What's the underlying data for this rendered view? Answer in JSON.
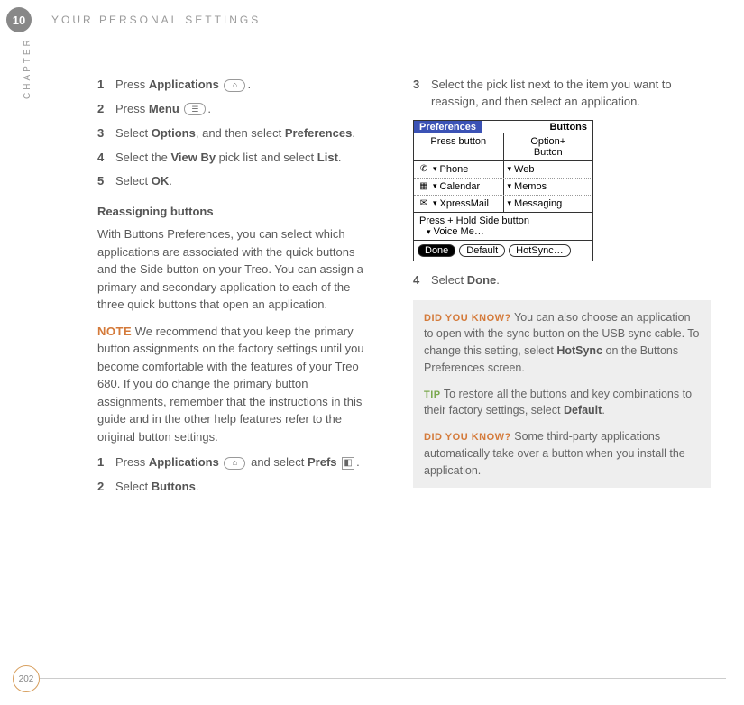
{
  "chapter_number": "10",
  "chapter_label": "CHAPTER",
  "section_title": "YOUR PERSONAL SETTINGS",
  "page_number": "202",
  "left": {
    "steps1": [
      {
        "num": "1",
        "pre": "Press ",
        "bold": "Applications",
        "post": " ",
        "icon": "applications-icon",
        "glyph": "⌂",
        "tail": "."
      },
      {
        "num": "2",
        "pre": "Press ",
        "bold": "Menu",
        "post": " ",
        "icon": "menu-icon",
        "glyph": "☰",
        "tail": "."
      },
      {
        "num": "3",
        "pre": "Select ",
        "bold": "Options",
        "post": ", and then select ",
        "bold2": "Preferences",
        "tail": "."
      },
      {
        "num": "4",
        "pre": "Select the ",
        "bold": "View By",
        "post": " pick list and select ",
        "bold2": "List",
        "tail": "."
      },
      {
        "num": "5",
        "pre": "Select ",
        "bold": "OK",
        "post": "",
        "tail": "."
      }
    ],
    "subhead": "Reassigning buttons",
    "para1": "With Buttons Preferences, you can select which applications are associated with the quick buttons and the Side button on your Treo. You can assign a primary and secondary application to each of the three quick buttons that open an application.",
    "note_label": "NOTE",
    "note_text": "We recommend that you keep the primary button assignments on the factory settings until you become comfortable with the features of your Treo 680. If you do change the primary button assignments, remember that the instructions in this guide and in the other help features refer to the original button settings.",
    "steps2": [
      {
        "num": "1",
        "pre": "Press ",
        "bold": "Applications",
        "post": " ",
        "icon": "applications-icon",
        "glyph": "⌂",
        "mid": " and select ",
        "bold2": "Prefs",
        "post2": " ",
        "icon2": "prefs-icon",
        "glyph2": "◧",
        "tail": "."
      },
      {
        "num": "2",
        "pre": "Select ",
        "bold": "Buttons",
        "post": "",
        "tail": "."
      }
    ]
  },
  "right": {
    "step3": {
      "num": "3",
      "text": "Select the pick list next to the item you want to reassign, and then select an application."
    },
    "step4": {
      "num": "4",
      "pre": "Select ",
      "bold": "Done",
      "tail": "."
    },
    "prefs": {
      "title_left": "Preferences",
      "title_right": "Buttons",
      "col_left": "Press button",
      "col_right_top": "Option+",
      "col_right_bottom": "Button",
      "rows": [
        {
          "icon": "phone-icon",
          "glyph": "✆",
          "label": "Phone",
          "alt": "Web"
        },
        {
          "icon": "calendar-icon",
          "glyph": "▦",
          "label": "Calendar",
          "alt": "Memos"
        },
        {
          "icon": "mail-icon",
          "glyph": "✉",
          "label": "XpressMail",
          "alt": "Messaging"
        }
      ],
      "side_label": "Press + Hold Side button",
      "side_value": "Voice Me…",
      "buttons": [
        "Done",
        "Default",
        "HotSync…"
      ]
    },
    "sidebar": {
      "dyk1_label": "DID YOU KNOW?",
      "dyk1_text_a": "You can also choose an application to open with the sync button on the USB sync cable. To change this setting, select ",
      "dyk1_bold": "HotSync",
      "dyk1_text_b": " on the Buttons Preferences screen.",
      "tip_label": "TIP",
      "tip_text_a": "To restore all the buttons and key combinations to their factory settings, select ",
      "tip_bold": "Default",
      "tip_text_b": ".",
      "dyk2_label": "DID YOU KNOW?",
      "dyk2_text": "Some third-party applications automatically take over a button when you install the application."
    }
  }
}
